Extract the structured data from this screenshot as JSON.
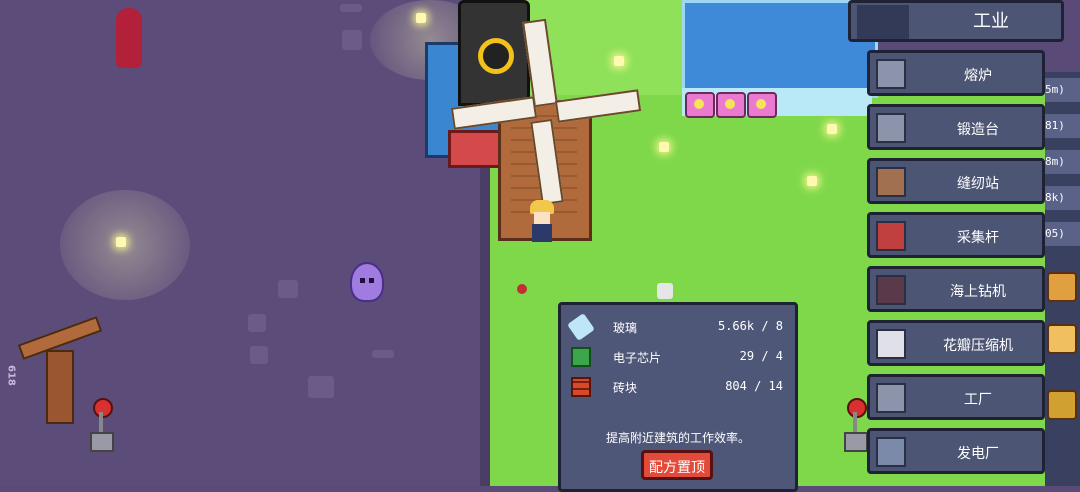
{
  "panel": {
    "resources": [
      {
        "name": "玻璃",
        "count": "5.66k / 8",
        "icon": "glass-icon",
        "color": "#bfe6f6"
      },
      {
        "name": "电子芯片",
        "count": "29 / 4",
        "icon": "chip-icon",
        "color": "#3aa84a"
      },
      {
        "name": "砖块",
        "count": "804 / 14",
        "icon": "brick-icon",
        "color": "#d44a2a"
      }
    ],
    "description": "提高附近建筑的工作效率。",
    "pin_button": "配方置顶"
  },
  "menu": {
    "category": "工业",
    "items": [
      {
        "label": "熔炉"
      },
      {
        "label": "锻造台"
      },
      {
        "label": "缝纫站"
      },
      {
        "label": "采集杆"
      },
      {
        "label": "海上钻机"
      },
      {
        "label": "花瓣压缩机"
      },
      {
        "label": "工厂"
      },
      {
        "label": "发电厂"
      }
    ]
  },
  "side_counts": [
    "5m)",
    "81)",
    "8m)",
    "8k)",
    "05)"
  ],
  "ballista_counter": "618"
}
